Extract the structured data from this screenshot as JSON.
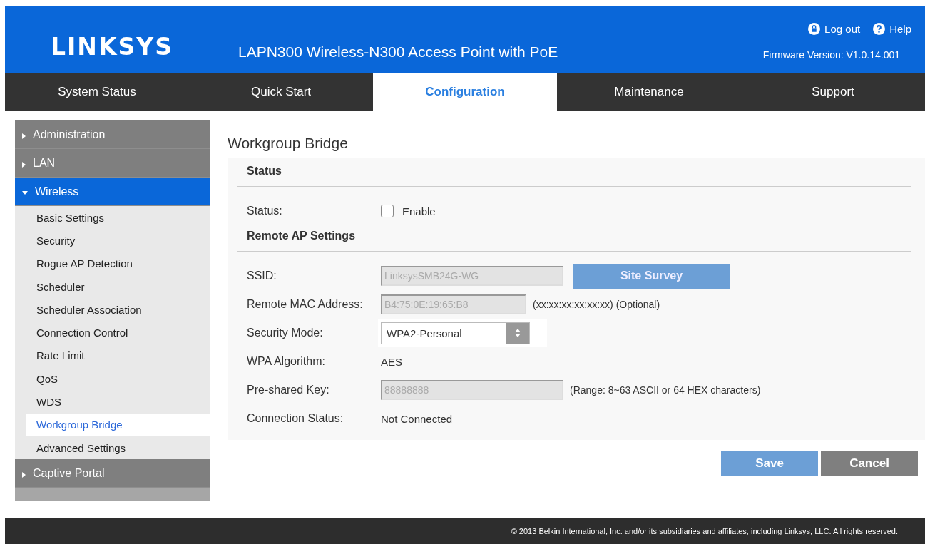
{
  "header": {
    "logo": "LINKSYS",
    "product": "LAPN300 Wireless-N300 Access Point with PoE",
    "links": [
      {
        "kind": "logout",
        "label": "Log out"
      },
      {
        "kind": "help",
        "label": "Help"
      }
    ],
    "firmware": "Firmware Version: V1.0.14.001"
  },
  "tabs": [
    {
      "label": "System Status",
      "selected": false
    },
    {
      "label": "Quick Start",
      "selected": false
    },
    {
      "label": "Configuration",
      "selected": true
    },
    {
      "label": "Maintenance",
      "selected": false
    },
    {
      "label": "Support",
      "selected": false
    }
  ],
  "sidebar": {
    "items": [
      {
        "label": "Administration",
        "expanded": false
      },
      {
        "label": "LAN",
        "expanded": false
      },
      {
        "label": "Wireless",
        "expanded": true,
        "children": [
          {
            "label": "Basic Settings",
            "selected": false
          },
          {
            "label": "Security",
            "selected": false
          },
          {
            "label": "Rogue AP Detection",
            "selected": false
          },
          {
            "label": "Scheduler",
            "selected": false
          },
          {
            "label": "Scheduler Association",
            "selected": false
          },
          {
            "label": "Connection Control",
            "selected": false
          },
          {
            "label": "Rate Limit",
            "selected": false
          },
          {
            "label": "QoS",
            "selected": false
          },
          {
            "label": "WDS",
            "selected": false
          },
          {
            "label": "Workgroup Bridge",
            "selected": true
          },
          {
            "label": "Advanced Settings",
            "selected": false
          }
        ]
      },
      {
        "label": "Captive Portal",
        "expanded": false
      }
    ]
  },
  "page_title": "Workgroup Bridge",
  "sections": [
    {
      "title": "Status",
      "rows": [
        {
          "kind": "checkbox",
          "label": "Status:",
          "option": "Enable",
          "checked": false
        }
      ]
    },
    {
      "title": "Remote AP Settings",
      "rows": [
        {
          "kind": "input",
          "label": "SSID:",
          "value": "LinksysSMB24G-WG",
          "disabled": true,
          "button": "Site Survey"
        },
        {
          "kind": "input",
          "label": "Remote MAC Address:",
          "value": "B4:75:0E:19:65:B8",
          "disabled": true,
          "hint": "(xx:xx:xx:xx:xx:xx) (Optional)"
        },
        {
          "kind": "select",
          "label": "Security Mode:",
          "value": "WPA2-Personal"
        },
        {
          "kind": "text",
          "label": "WPA Algorithm:",
          "value": "AES"
        },
        {
          "kind": "input",
          "label": "Pre-shared Key:",
          "value": "88888888",
          "disabled": true,
          "hint": "(Range: 8~63 ASCII or 64 HEX characters)"
        },
        {
          "kind": "text",
          "label": "Connection Status:",
          "value": "Not Connected"
        }
      ]
    }
  ],
  "buttons": [
    {
      "kind": "save",
      "label": "Save"
    },
    {
      "kind": "cancel",
      "label": "Cancel"
    }
  ],
  "footer": "© 2013 Belkin International, Inc. and/or its subsidiaries and affiliates, including Linksys, LLC. All rights reserved."
}
